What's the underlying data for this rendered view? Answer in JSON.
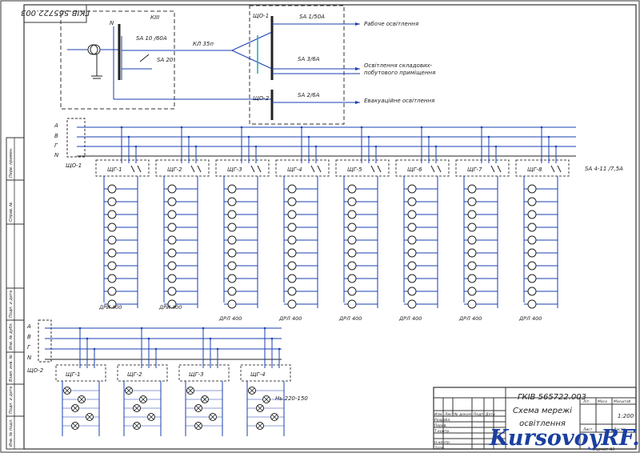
{
  "drawing_code": "ГКІВ 565722.003",
  "top_block": {
    "kiii": "КІІІ",
    "n_label": "N",
    "sa1": "SA 10 /60A",
    "sa2": "SA 20",
    "cable": "КЛ 35п",
    "shch1": "ЩО-1",
    "shch2": "ЩО-2",
    "sa_a": "SA 1/50A",
    "sa_b": "SA 3/6A",
    "sa_c": "SA 2/6A",
    "line1": "Рабоче освітлення",
    "line2a": "Освітлення складових-",
    "line2b": "побутового приміщення",
    "line3": "Евакуаційне освітлення"
  },
  "bus_main": {
    "phases": [
      "A",
      "B",
      "Г",
      "N"
    ],
    "switch": "ЩО-1"
  },
  "panels_main": [
    "ЩГ-1",
    "ЩГ-2",
    "ЩГ-3",
    "ЩГ-4",
    "ЩГ-5",
    "ЩГ-6",
    "ЩГ-7",
    "ЩГ-8"
  ],
  "panels_main_note": "SA 4-11 /7,5A",
  "lamp_labels": [
    "ДРИ 400",
    "ДРИ 400",
    "ДРЛ 400",
    "ДРЛ 400",
    "ДРЛ 400",
    "ДРЛ 400",
    "ДРЛ 400",
    "ДРЛ 400"
  ],
  "bus_low": {
    "phases": [
      "A",
      "B",
      "Г",
      "N"
    ],
    "switch": "ЩО-2"
  },
  "panels_low": [
    "ЩГ-1",
    "ЩГ-2",
    "ЩГ-3",
    "ЩГ-4"
  ],
  "panels_low_note": "Нь 220-150",
  "title_block": {
    "code": "ГКІВ 565722.003",
    "title1": "Схема мережі",
    "title2": "освітлення",
    "sheet": "1:200",
    "format": "Формат  А3",
    "h_izm": "Изм.",
    "h_list": "Лист",
    "h_doc": "№ докум.",
    "h_sign": "Подп.",
    "h_date": "Дата",
    "r_razrab": "Розробл.",
    "r_prov": "Перев.",
    "r_tkontr": "Т.контр.",
    "r_nkontr": "Н.контр.",
    "r_utv": "Затв.",
    "l_lit": "Літ.",
    "l_mass": "Маса",
    "l_scale": "Масштаб",
    "l_list": "Лист",
    "l_listov": "Листів"
  },
  "left_stamp": [
    "Перв. примен.",
    "Справ. №",
    "Подп. и дата",
    "Инв. № дубл.",
    "Взам. инв. №",
    "Подп. и дата",
    "Инв. № подл."
  ],
  "watermark": "KursovoyRF.ru"
}
